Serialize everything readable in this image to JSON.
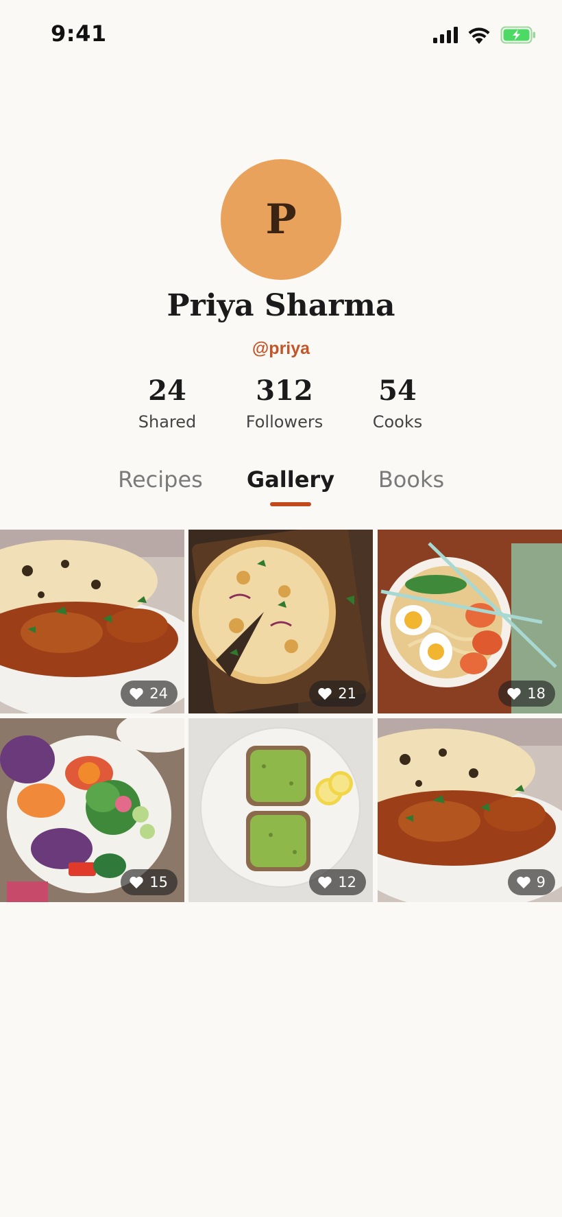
{
  "status_bar": {
    "time": "9:41",
    "icons": [
      "signal-icon",
      "wifi-icon",
      "battery-charging-icon"
    ],
    "battery_color": "#4cd964"
  },
  "profile": {
    "avatar_initial": "P",
    "avatar_color": "#e9a25c",
    "name": "Priya Sharma",
    "handle": "@priya",
    "accent_color": "#c2562a"
  },
  "stats": [
    {
      "value": "24",
      "label": "Shared"
    },
    {
      "value": "312",
      "label": "Followers"
    },
    {
      "value": "54",
      "label": "Cooks"
    }
  ],
  "tabs": [
    {
      "label": "Recipes",
      "active": false
    },
    {
      "label": "Gallery",
      "active": true
    },
    {
      "label": "Books",
      "active": false
    }
  ],
  "gallery": [
    {
      "dish": "curry-with-naan",
      "likes": "24"
    },
    {
      "dish": "pizza",
      "likes": "21"
    },
    {
      "dish": "ramen",
      "likes": "18"
    },
    {
      "dish": "salad",
      "likes": "15"
    },
    {
      "dish": "avocado-toast",
      "likes": "12"
    },
    {
      "dish": "curry-with-naan",
      "likes": "9"
    }
  ]
}
